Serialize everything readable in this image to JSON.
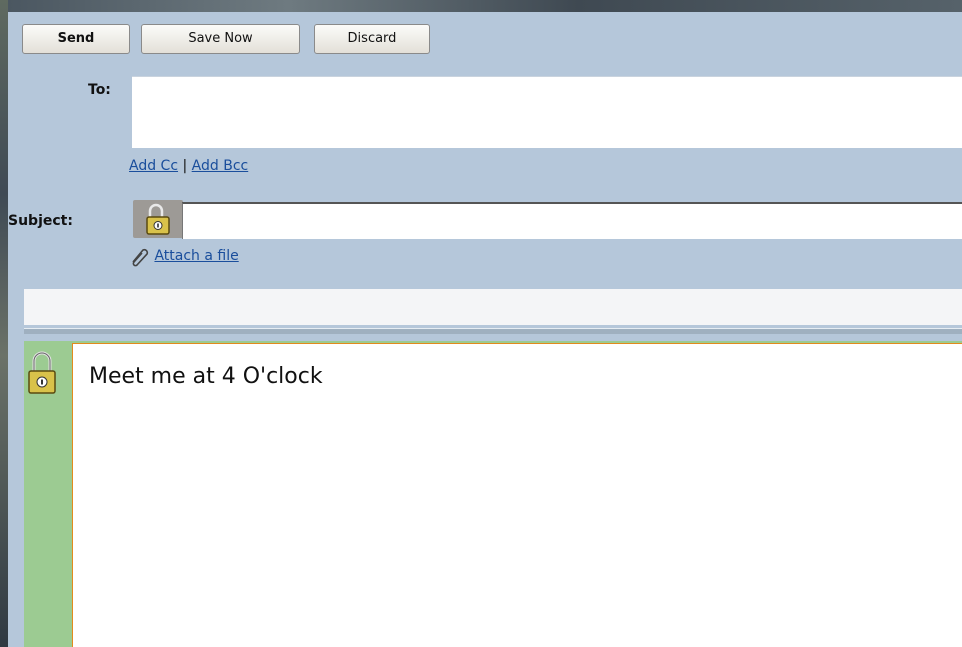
{
  "toolbar": {
    "send_label": "Send",
    "save_label": "Save Now",
    "discard_label": "Discard"
  },
  "fields": {
    "to_label": "To:",
    "to_value": "",
    "add_cc_label": "Add Cc",
    "separator": "|",
    "add_bcc_label": "Add Bcc",
    "subject_label": "Subject:",
    "subject_value": "",
    "attach_label": "Attach a file"
  },
  "body": {
    "text": "Meet me at 4 O'clock"
  },
  "icons": {
    "subject_lock": "padlock-icon",
    "body_lock": "padlock-icon",
    "attach": "paperclip-icon"
  },
  "colors": {
    "header_bg": "#b5c7da",
    "body_side_bg": "#9ccb92",
    "editor_border": "#e38a1c",
    "link": "#1a4e9c"
  }
}
